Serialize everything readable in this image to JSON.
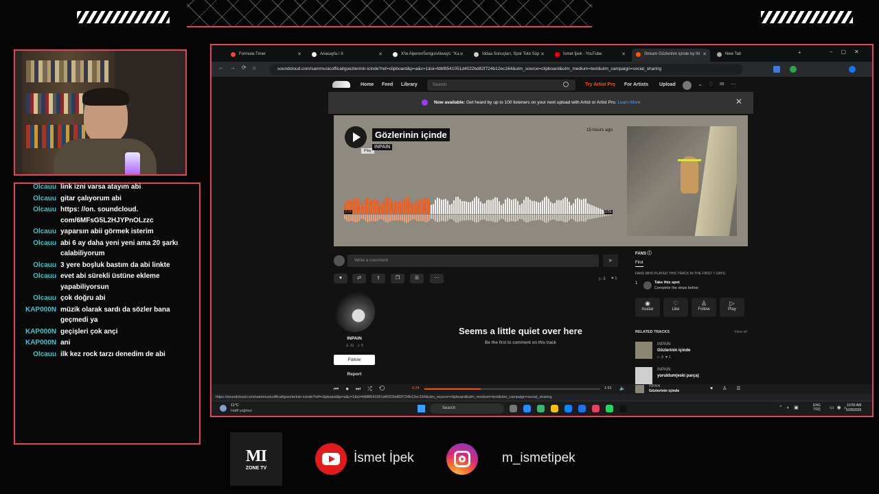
{
  "overlay": {
    "chat": [
      {
        "user": "Olcauu",
        "msg": "link izni varsa atayım abi"
      },
      {
        "user": "Olcauu",
        "msg": "gitar çalıyorum abi"
      },
      {
        "user": "Olcauu",
        "msg": "https: //on. soundcloud. com/6MFsG5L2HJYPnOLzzc"
      },
      {
        "user": "Olcauu",
        "msg": "yaparsın abii görmek isterim"
      },
      {
        "user": "Olcauu",
        "msg": "abi 6 ay daha yeni yeni ama 20 şarkı calabiliyorum"
      },
      {
        "user": "Olcauu",
        "msg": "3 yere boşluk bastım da abi linkte"
      },
      {
        "user": "Olcauu",
        "msg": "evet abi sürekli üstüne ekleme yapabiliyorsun"
      },
      {
        "user": "Olcauu",
        "msg": "çok doğru abi"
      },
      {
        "user": "KAP000N",
        "msg": "müzik olarak sardı da sözler bana geçmedi ya"
      },
      {
        "user": "KAP000N",
        "msg": "geçişleri çok ançi"
      },
      {
        "user": "KAP000N",
        "msg": "ani"
      },
      {
        "user": "Olcauu",
        "msg": "ilk kez rock tarzı denedim de abi"
      }
    ],
    "logo_text": "MI",
    "logo_sub": "ZONE TV",
    "youtube_name": "İsmet İpek",
    "instagram_name": "m_ismetipek"
  },
  "browser": {
    "tabs": [
      {
        "label": "Formula-Timer",
        "color": "#e44"
      },
      {
        "label": "Anasayfa / X",
        "color": "#fff"
      },
      {
        "label": "X'te AlperenSengunAlways: \"Ka",
        "color": "#fff"
      },
      {
        "label": "İddaa Sonuçları, Spor Toto Süp",
        "color": "#ccc"
      },
      {
        "label": "İsmet İpek - YouTube",
        "color": "#f00"
      },
      {
        "label": "Stream Gözlerinin içinde by IN",
        "color": "#f50"
      },
      {
        "label": "New Tab",
        "color": "#aaa"
      }
    ],
    "url": "soundcloud.com/sammusicoffical/goezlerinin-icinde?ref=clipboard&p=a&c=1&si=fdbf8541051d4022bd82f724b12ec164&utm_source=clipboard&utm_medium=text&utm_campaign=social_sharing",
    "status_url": "https://soundcloud.com/sammusicoffical/goezlerinin-icinde?ref=clipboard&p=a&c=1&si=fdbf8541051d4022bd82f724b12ec164&utm_source=clipboard&utm_medium=text&utm_campaign=social_sharing"
  },
  "sc": {
    "nav": {
      "home": "Home",
      "feed": "Feed",
      "library": "Library",
      "search_placeholder": "Search",
      "try_pro": "Try Artist Pro",
      "for_artists": "For Artists",
      "upload": "Upload"
    },
    "banner": {
      "bold": "Now available:",
      "text": "Get heard by up to 100 listeners on your next upload with Artist or Artist Pro.",
      "link": "Learn More"
    },
    "track": {
      "title": "Gözlerinin içinde",
      "artist": "INPAIN",
      "time_ago": "15 hours ago",
      "tooltip": "Play",
      "elapsed": "0:24",
      "duration": "1:51",
      "progress": 0.32
    },
    "comment_placeholder": "Write a comment",
    "stats": {
      "plays": "3",
      "likes": "1"
    },
    "artist_card": {
      "name": "INPAIN",
      "followers": "11",
      "tracks": "9",
      "follow": "Follow",
      "report": "Report"
    },
    "quiet": {
      "title": "Seems a little quiet over here",
      "sub": "Be the first to comment on this track"
    },
    "fans": {
      "title": "FANS",
      "tab": "First",
      "desc": "FANS WHO PLAYED THIS TRACK IN THE FIRST 7 DAYS:",
      "rank": "1",
      "spot_title": "Take this spot",
      "spot_sub": "Complete the steps below:",
      "actions": [
        "Avatar",
        "Like",
        "Follow",
        "Play"
      ]
    },
    "related": {
      "title": "RELATED TRACKS",
      "view_all": "View all",
      "items": [
        {
          "artist": "INPAIN",
          "title": "Gözlerinin içinde",
          "plays": "3",
          "likes": "1"
        },
        {
          "artist": "INPAIN",
          "title": "yoruldum(eski parça)"
        }
      ]
    },
    "player": {
      "elapsed": "0:24",
      "duration": "1:51",
      "artist": "INPAIN",
      "title": "Gözlerinin içinde"
    }
  },
  "taskbar": {
    "weather_temp": "11°C",
    "weather_desc": "Hafif yağmur",
    "search": "Search",
    "lang1": "ENG",
    "lang2": "TRQ",
    "time": "10:55 AM",
    "date": "5/28/2026"
  }
}
